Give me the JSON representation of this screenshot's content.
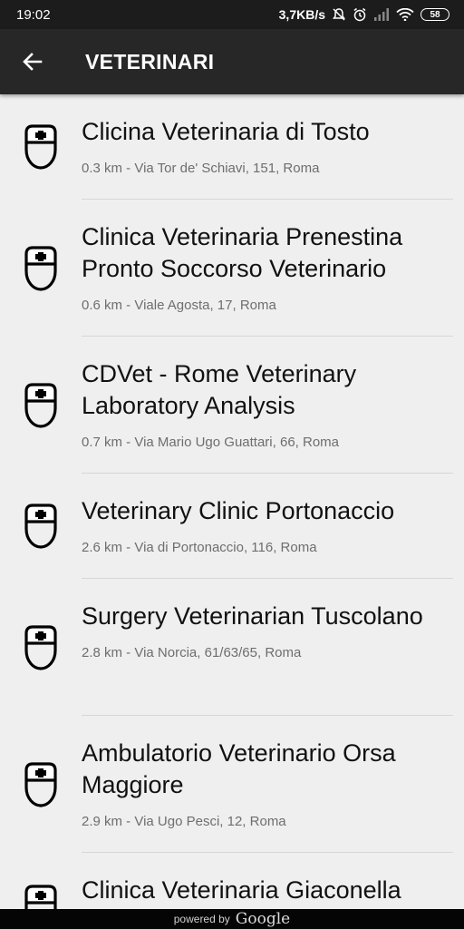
{
  "status_bar": {
    "time": "19:02",
    "network_speed": "3,7KB/s",
    "battery_level": "58"
  },
  "header": {
    "title": "VETERINARI",
    "back_icon": "arrow-left-icon"
  },
  "list": {
    "item_icon": "vet-nurse-icon",
    "items": [
      {
        "name": "Clicina Veterinaria di Tosto",
        "detail": "0.3 km - Via Tor de' Schiavi, 151, Roma"
      },
      {
        "name": "Clinica Veterinaria Prenestina Pronto Soccorso Veterinario",
        "detail": "0.6 km - Viale Agosta, 17, Roma"
      },
      {
        "name": "CDVet - Rome Veterinary Laboratory Analysis",
        "detail": "0.7 km - Via Mario Ugo Guattari, 66, Roma"
      },
      {
        "name": "Veterinary Clinic Portonaccio",
        "detail": "2.6 km - Via di Portonaccio, 116, Roma"
      },
      {
        "name": "Surgery Veterinarian Tuscolano",
        "detail": "2.8 km - Via Norcia, 61/63/65, Roma"
      },
      {
        "name": "Ambulatorio Veterinario Orsa Maggiore",
        "detail": "2.9 km - Via Ugo Pesci, 12, Roma"
      },
      {
        "name": "Clinica Veterinaria Giaconella",
        "detail": ""
      }
    ]
  },
  "footer": {
    "powered_by": "powered by",
    "brand": "Google"
  }
}
